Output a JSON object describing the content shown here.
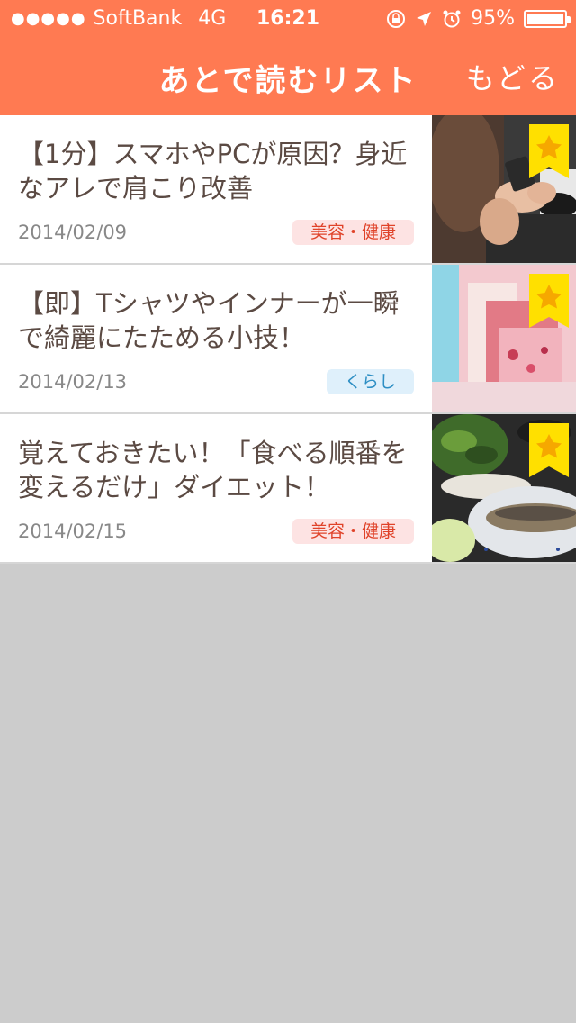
{
  "status_bar": {
    "signal": "●●●●●",
    "carrier": "SoftBank",
    "network": "4G",
    "time": "16:21",
    "battery": "95%"
  },
  "header": {
    "title": "あとで読むリスト",
    "back_label": "もどる",
    "color": "#ff7a52"
  },
  "articles": [
    {
      "title": "【1分】スマホやPCが原因？身近なアレで肩こり改善",
      "date": "2014/02/09",
      "category": "美容・健康",
      "thumb_icon": "hands-smartphone-photo",
      "bookmark_icon": "star-bookmark-icon"
    },
    {
      "title": "【即】Tシャツやインナーが一瞬で綺麗にたためる小技！",
      "date": "2014/02/13",
      "category": "くらし",
      "thumb_icon": "folded-clothes-photo",
      "bookmark_icon": "star-bookmark-icon"
    },
    {
      "title": "覚えておきたい！「食べる順番を変えるだけ」ダイエット！",
      "date": "2014/02/15",
      "category": "美容・健康",
      "thumb_icon": "grilled-fish-meal-photo",
      "bookmark_icon": "star-bookmark-icon"
    }
  ]
}
